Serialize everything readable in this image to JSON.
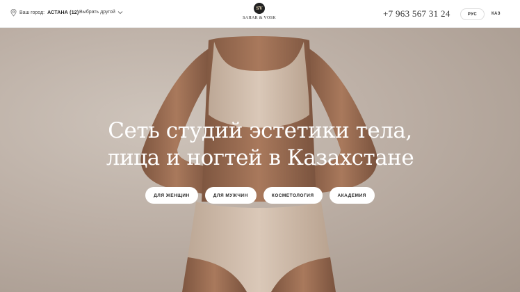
{
  "header": {
    "city_label": "Ваш город:",
    "city_value": "АСТАНА (12)",
    "choose_label": "Выбрать другой",
    "logo_mark": "SV",
    "logo_text": "SAHAR & VOSK",
    "phone": "+7 963 567 31 24",
    "lang_active": "РУС",
    "lang_other": "КАЗ"
  },
  "hero": {
    "title_line1": "Сеть студий эстетики тела,",
    "title_line2": "лица и ногтей в Казахстане",
    "buttons": [
      {
        "label": "ДЛЯ ЖЕНЩИН"
      },
      {
        "label": "ДЛЯ МУЖЧИН"
      },
      {
        "label": "КОСМЕТОЛОГИЯ"
      },
      {
        "label": "АКАДЕМИЯ"
      }
    ]
  },
  "icons": {
    "location": "location-pin-icon",
    "chevron": "chevron-down-icon"
  },
  "colors": {
    "header_bg": "#ffffff",
    "hero_bg": "#bcafa5",
    "skin": "#9a6d52",
    "underwear": "#d2bfae",
    "button_bg": "#ffffff",
    "title_text": "#ffffff"
  }
}
